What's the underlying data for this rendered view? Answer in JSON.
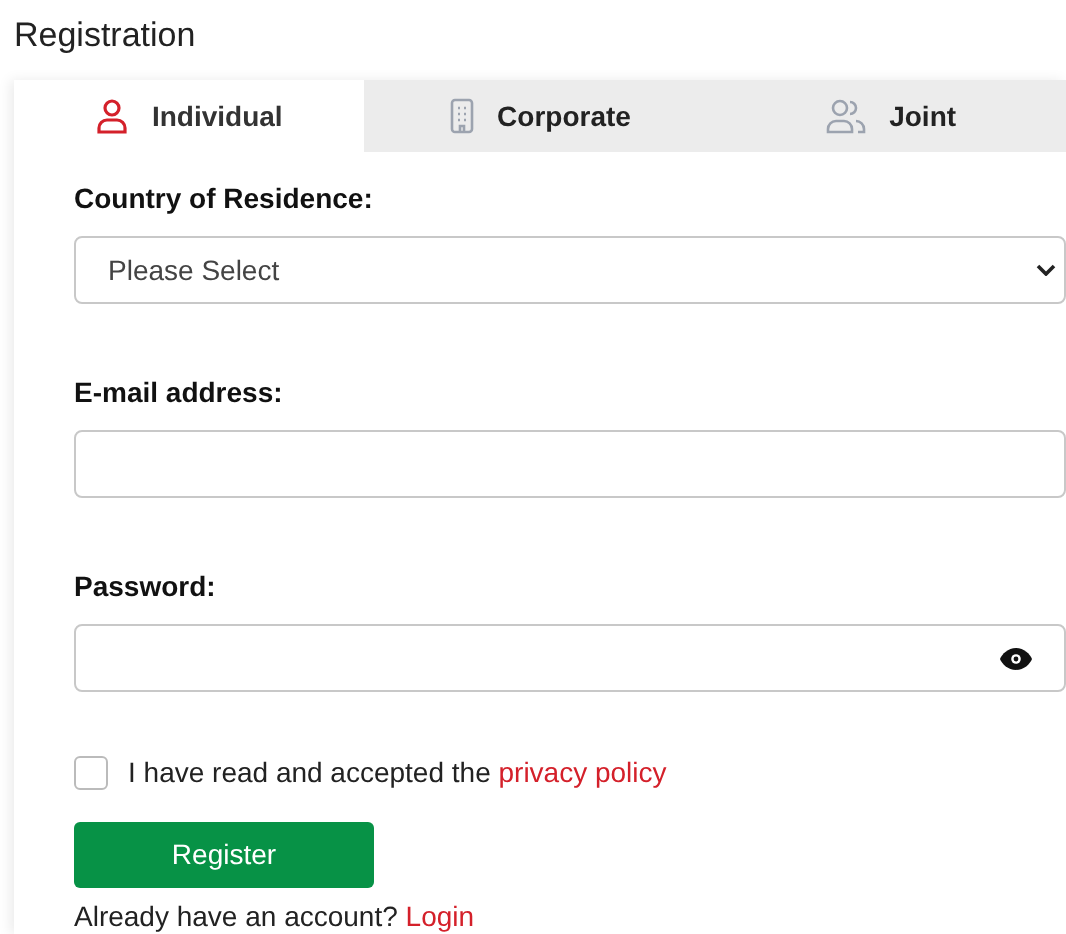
{
  "page": {
    "title": "Registration"
  },
  "tabs": [
    {
      "label": "Individual",
      "kind": "person",
      "selected": true
    },
    {
      "label": "Corporate",
      "kind": "building",
      "selected": false
    },
    {
      "label": "Joint",
      "kind": "people",
      "selected": false
    }
  ],
  "country": {
    "label": "Country of Residence:",
    "value": "Please Select"
  },
  "email": {
    "label": "E-mail address:"
  },
  "password": {
    "label": "Password:"
  },
  "consent": {
    "text": "I have read and accepted the",
    "link": "privacy policy",
    "checked": false
  },
  "register_button": "Register",
  "login_prompt": {
    "text": "Already have an account?",
    "link": "Login"
  }
}
